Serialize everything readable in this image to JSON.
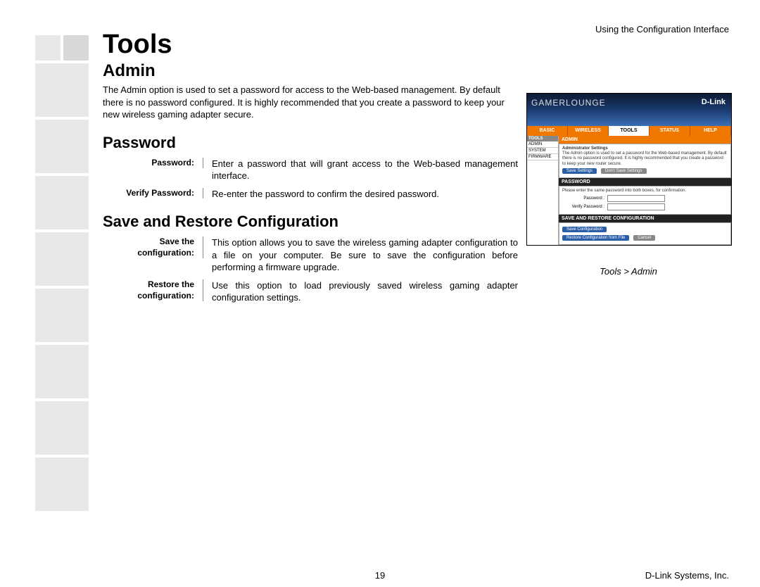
{
  "header": "Using the Configuration Interface",
  "page_number": "19",
  "company": "D-Link Systems, Inc.",
  "title": "Tools",
  "sections": {
    "admin": {
      "heading": "Admin",
      "intro": "The Admin option is used to set a password for access to the Web-based management. By default there is no password configured. It is highly recommended that you create a password to keep your new wireless gaming adapter secure."
    },
    "password": {
      "heading": "Password",
      "items": [
        {
          "term": "Password:",
          "desc": "Enter a password that will grant access to the Web-based management interface."
        },
        {
          "term": "Verify Password:",
          "desc": "Re-enter the password to confirm the desired password."
        }
      ]
    },
    "saverestore": {
      "heading": "Save and Restore Configuration",
      "items": [
        {
          "term": "Save the configuration:",
          "desc": "This option allows you to save the wireless gaming adapter configuration to a file on your computer. Be sure to save the configuration before performing a firmware upgrade."
        },
        {
          "term": "Restore the configuration:",
          "desc": "Use this option to load previously saved wireless gaming adapter configuration settings."
        }
      ]
    }
  },
  "screenshot": {
    "caption": "Tools > Admin",
    "logo_left": "GAMERLOUNGE",
    "logo_right": "D-Link",
    "tabs": [
      "BASIC",
      "WIRELESS",
      "TOOLS",
      "STATUS",
      "HELP"
    ],
    "active_tab": 2,
    "side_header": "TOOLS",
    "side_items": [
      "ADMIN",
      "SYSTEM",
      "FIRMWARE"
    ],
    "panel_admin": {
      "bar": "ADMIN",
      "sub": "Administrator Settings",
      "text": "The Admin option is used to set a password for the Web-based management. By default there is no password configured. It is highly recommended that you create a password to keep your new router secure.",
      "btn_save": "Save Settings",
      "btn_dont": "Don't Save Settings"
    },
    "panel_password": {
      "bar": "PASSWORD",
      "hint": "Please enter the same password into both boxes, for confirmation.",
      "label1": "Password :",
      "label2": "Verify Password :"
    },
    "panel_sr": {
      "bar": "SAVE AND RESTORE CONFIGURATION",
      "btn_save": "Save Configuration",
      "btn_restore": "Restore Configuration from File",
      "btn_cancel": "Cancel"
    }
  }
}
